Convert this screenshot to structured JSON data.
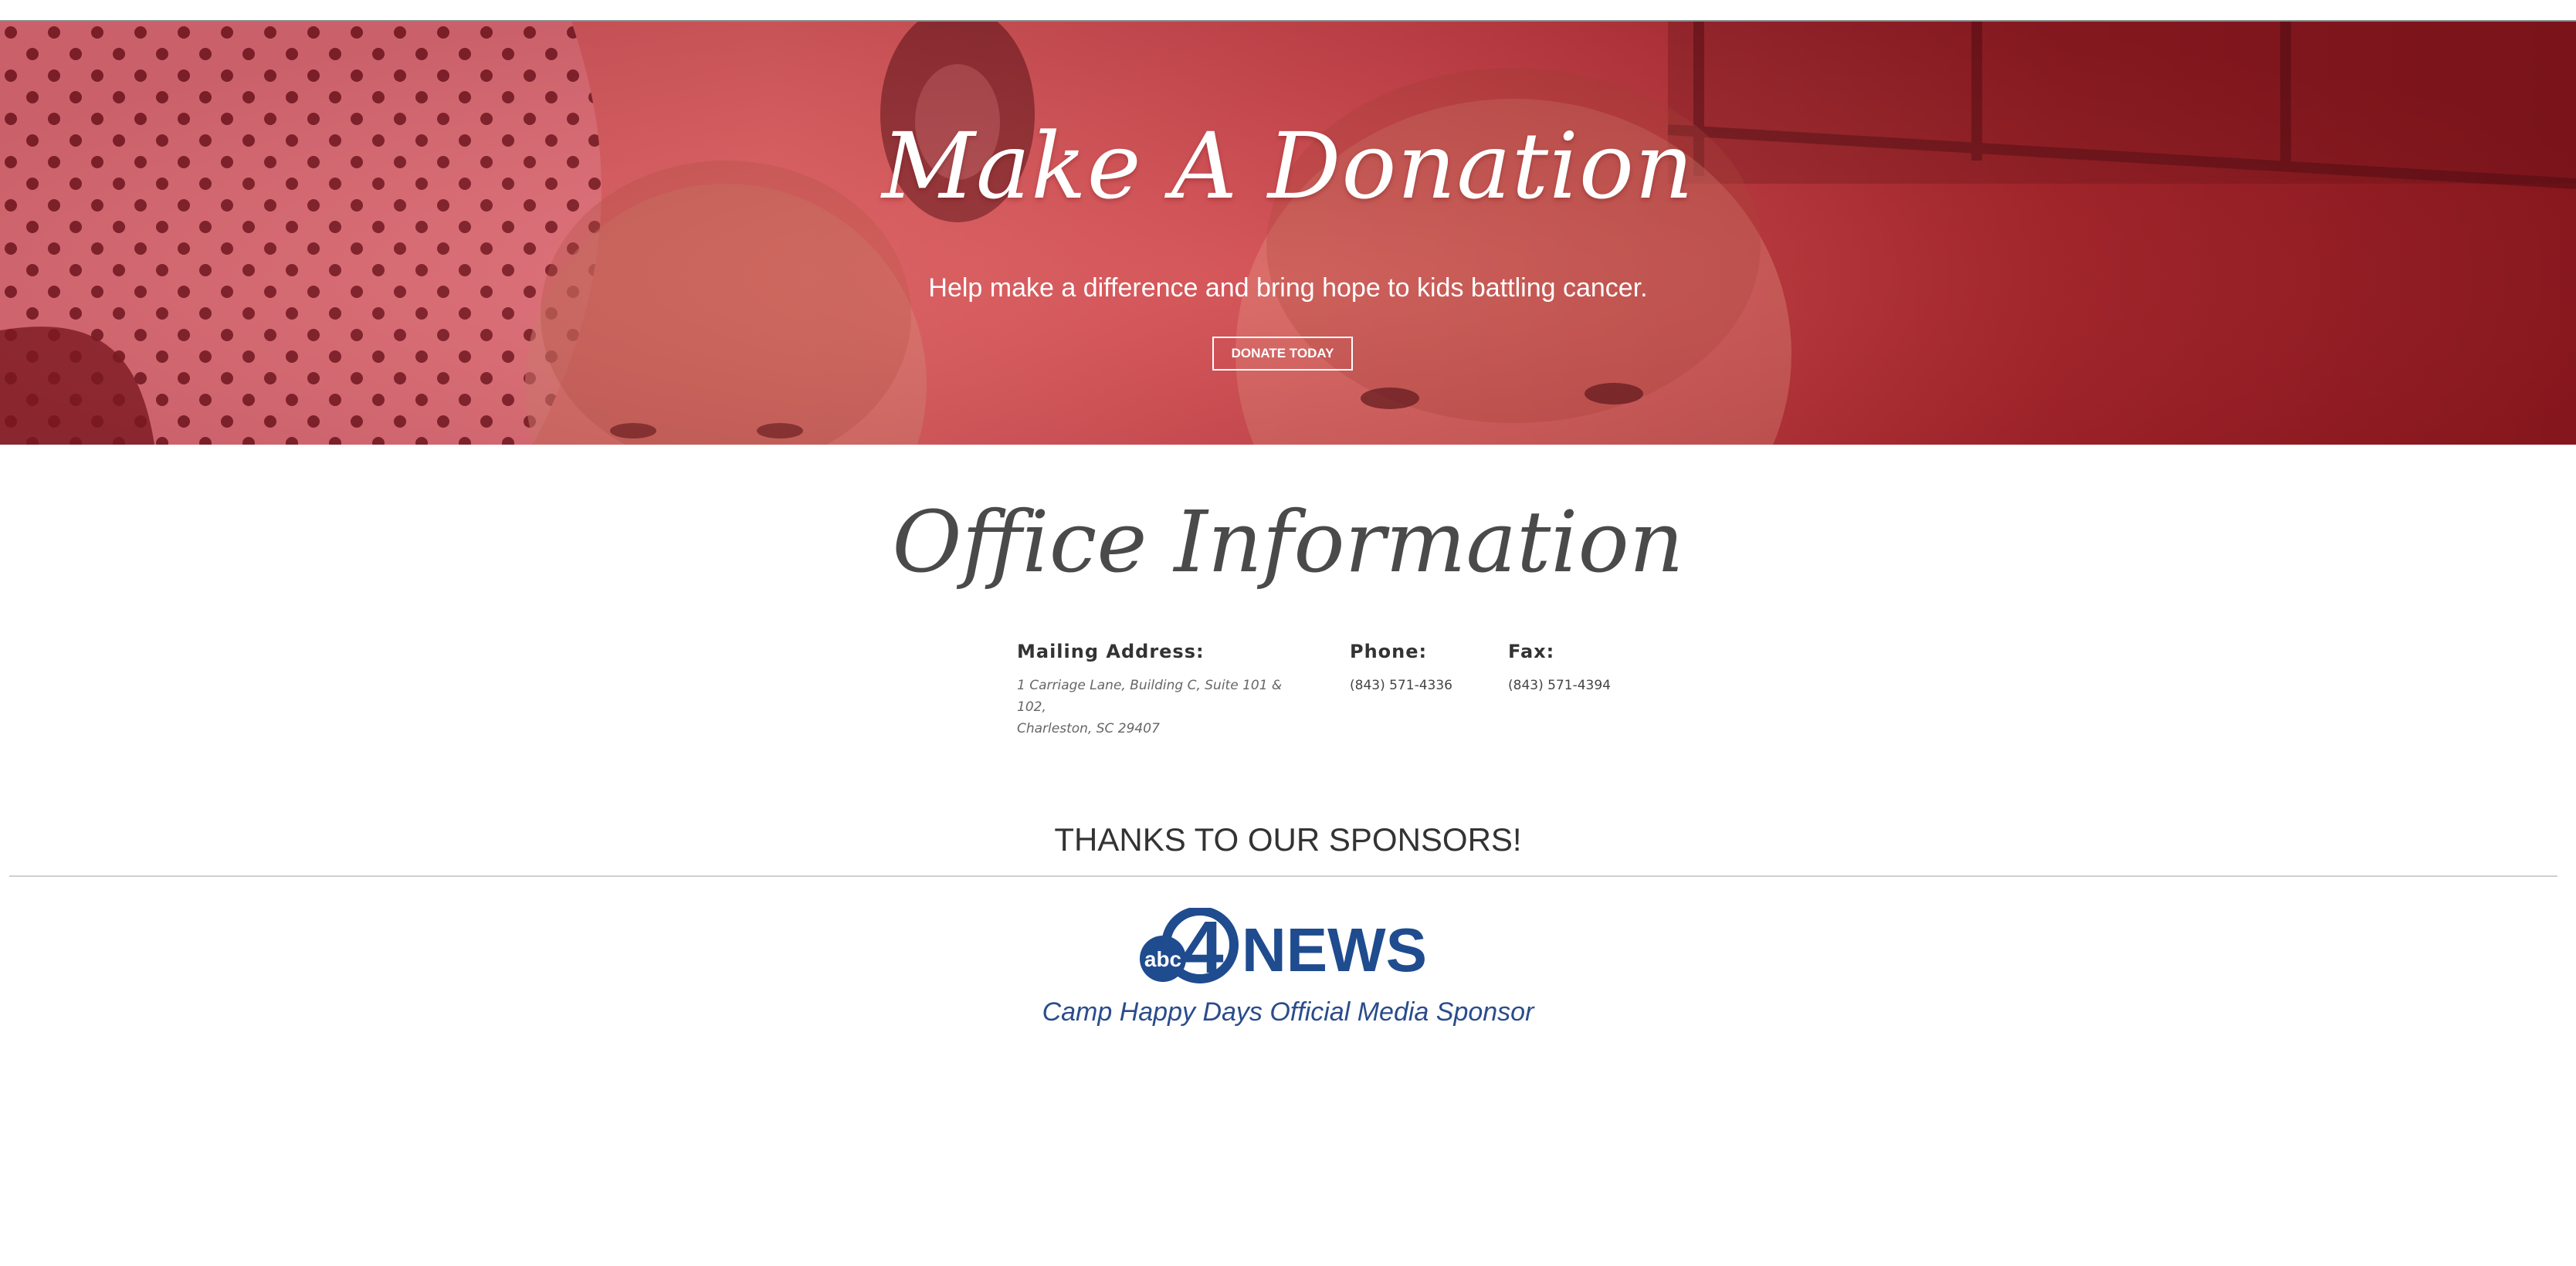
{
  "hero": {
    "title": "Make A Donation",
    "subtitle": "Help make a difference and bring hope to kids battling cancer.",
    "donate_button_label": "DONATE TODAY",
    "overlay_color": "#c7484f"
  },
  "office": {
    "title": "Office Information",
    "mailing": {
      "label": "Mailing Address:",
      "line1": "1 Carriage Lane, Building C, Suite 101 & 102,",
      "line2": "Charleston, SC 29407"
    },
    "phone": {
      "label": "Phone:",
      "value": "(843) 571-4336"
    },
    "fax": {
      "label": "Fax:",
      "value": "(843) 571-4394"
    }
  },
  "sponsors": {
    "heading": "THANKS TO OUR SPONSORS!",
    "logo": {
      "abc_text": "abc",
      "number_text": "4",
      "news_text": "NEWS",
      "brand_color": "#1f4b8f"
    },
    "caption": "Camp Happy Days Official Media Sponsor"
  }
}
